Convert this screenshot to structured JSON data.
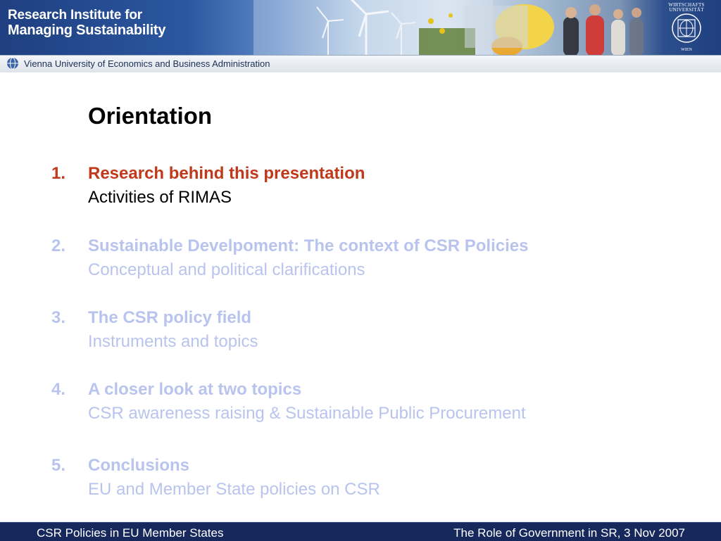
{
  "header": {
    "org_line1": "Research Institute for",
    "org_line2": "Managing Sustainability",
    "university": "Vienna University of Economics and Business Administration",
    "seal_text_top": "WIRTSCHAFTS UNIVERSITÄT",
    "seal_text_bottom": "WIEN"
  },
  "slide": {
    "title": "Orientation",
    "items": [
      {
        "number": "1.",
        "heading": "Research behind this presentation",
        "sub": "Activities of RIMAS",
        "state": "active"
      },
      {
        "number": "2.",
        "heading": "Sustainable Develpoment: The context of CSR Policies",
        "sub": "Conceptual and political clarifications",
        "state": "muted"
      },
      {
        "number": "3.",
        "heading": "The CSR policy field",
        "sub": "Instruments and topics",
        "state": "muted"
      },
      {
        "number": "4.",
        "heading": "A closer look at two topics",
        "sub": "CSR awareness raising & Sustainable Public Procurement",
        "state": "muted"
      },
      {
        "number": "5.",
        "heading": "Conclusions",
        "sub": "EU and Member State policies on CSR",
        "state": "muted"
      }
    ]
  },
  "footer": {
    "left": "CSR Policies in EU Member States",
    "right": "The Role of Government in SR, 3 Nov 2007"
  },
  "colors": {
    "active": "#c0391b",
    "muted": "#b9c4ee",
    "footer_bg": "#17285c",
    "header_bg": "#1f3f80"
  }
}
